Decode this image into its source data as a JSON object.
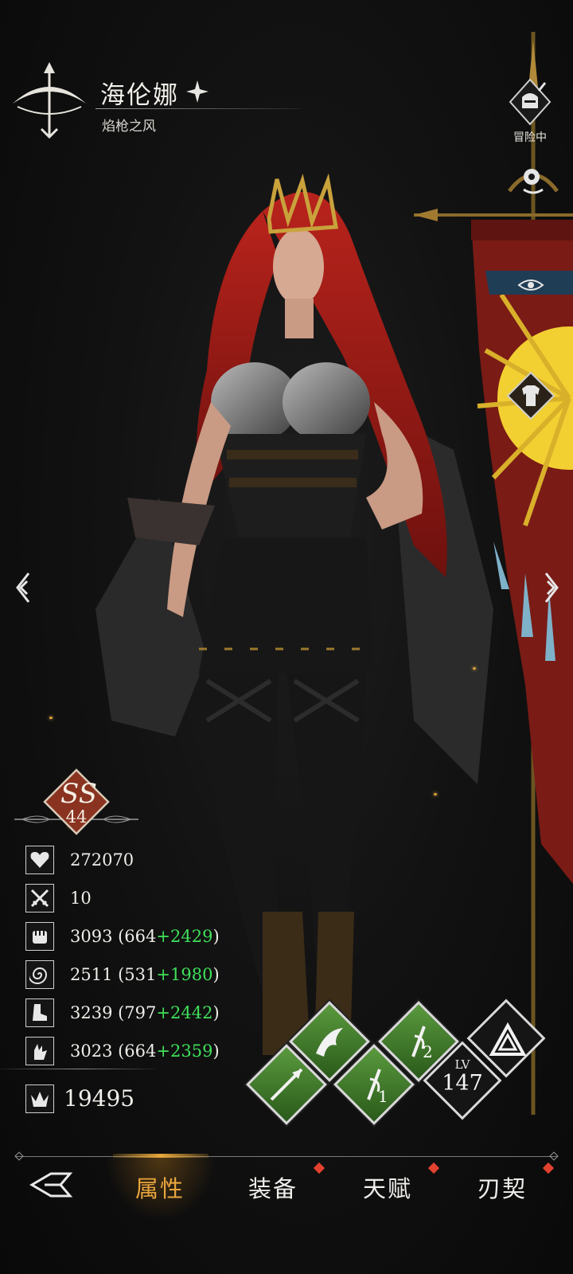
{
  "hero": {
    "name": "海伦娜",
    "title": "焰枪之风"
  },
  "status_button": {
    "label": "冒险中"
  },
  "rank": {
    "letters": "SS",
    "level": "44"
  },
  "stats": [
    {
      "icon": "heart-icon",
      "text": "272070",
      "base": "",
      "bonus": ""
    },
    {
      "icon": "crossed-swords-icon",
      "text": "10",
      "base": "",
      "bonus": ""
    },
    {
      "icon": "fist-icon",
      "text": "3093 (664",
      "bonus": "+2429",
      "close": ")"
    },
    {
      "icon": "swirl-icon",
      "text": "2511 (531",
      "bonus": "+1980",
      "close": ")"
    },
    {
      "icon": "boot-icon",
      "text": "3239 (797",
      "bonus": "+2442",
      "close": ")"
    },
    {
      "icon": "hand-icon",
      "text": "3023 (664",
      "bonus": "+2359",
      "close": ")"
    }
  ],
  "power": {
    "icon": "crown-icon",
    "value": "19495"
  },
  "level": {
    "label": "LV",
    "value": "147"
  },
  "skills": [
    {
      "icon": "dragon-skill-icon"
    },
    {
      "icon": "spear-skill-icon"
    },
    {
      "icon": "sword-2-skill-icon",
      "num": "2"
    },
    {
      "icon": "sword-1-skill-icon",
      "num": "1"
    }
  ],
  "nav": {
    "tabs": [
      {
        "label": "属性",
        "active": true,
        "alert": false
      },
      {
        "label": "装备",
        "active": false,
        "alert": true
      },
      {
        "label": "天赋",
        "active": false,
        "alert": true
      },
      {
        "label": "刃契",
        "active": false,
        "alert": true
      }
    ]
  },
  "colors": {
    "accent": "#e9a53d",
    "bonus_green": "#3fe05a",
    "alert_red": "#e3412f",
    "skill_green": "#4c8a34",
    "rank_red": "#8a3320"
  }
}
